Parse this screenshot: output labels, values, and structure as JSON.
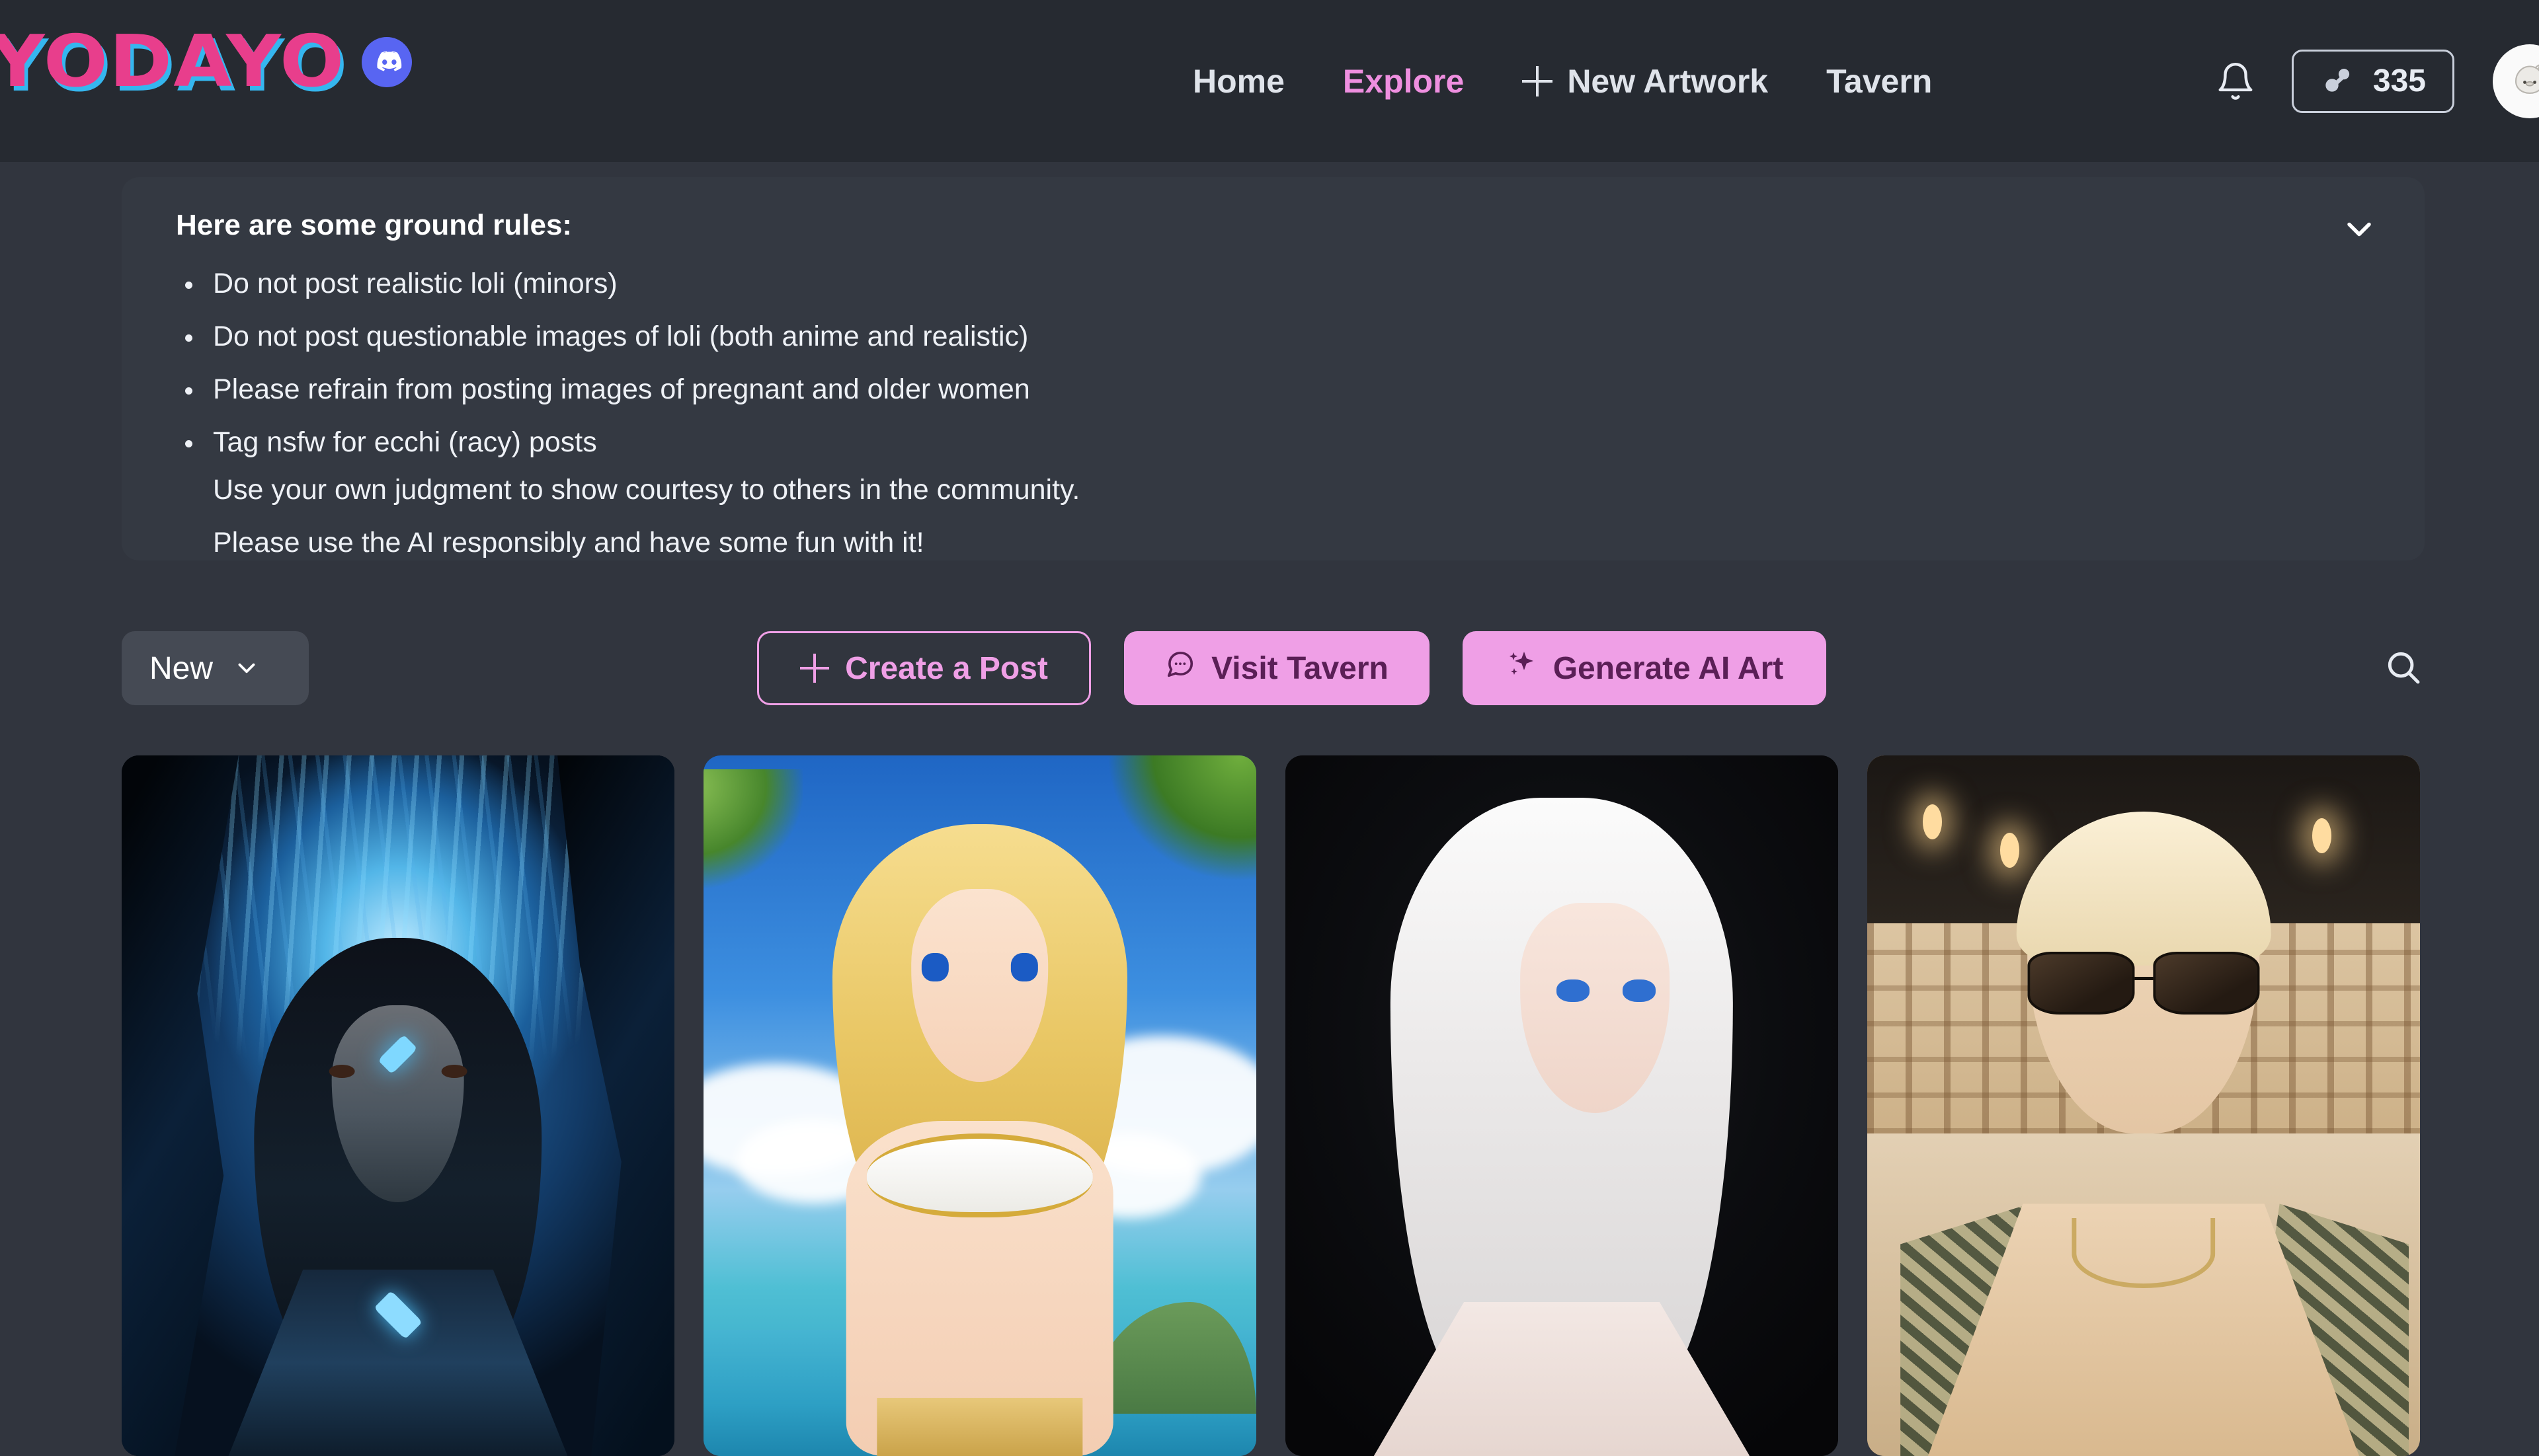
{
  "header": {
    "logo_text": "YODAYO",
    "discord_icon": "discord-icon",
    "nav": [
      {
        "label": "Home",
        "active": false,
        "icon": null
      },
      {
        "label": "Explore",
        "active": true,
        "icon": null
      },
      {
        "label": "New Artwork",
        "active": false,
        "icon": "plus-icon"
      },
      {
        "label": "Tavern",
        "active": false,
        "icon": null
      }
    ],
    "notifications_icon": "bell-icon",
    "coin": {
      "icon": "coin-icon",
      "amount": "335"
    },
    "avatar": "user-avatar"
  },
  "rules_panel": {
    "title": "Here are some ground rules:",
    "items": [
      "Do not post realistic loli (minors)",
      "Do not post questionable images of loli (both anime and realistic)",
      "Please refrain from posting images of pregnant and older women",
      "Tag nsfw for ecchi (racy) posts"
    ],
    "footer_lines": [
      "Use your own judgment to show courtesy to others in the community.",
      "Please use the AI responsibly and have some fun with it!"
    ],
    "collapse_icon": "chevron-down-icon"
  },
  "toolbar": {
    "sort": {
      "value": "New",
      "icon": "chevron-down-icon"
    },
    "create_post_label": "Create a Post",
    "visit_tavern_label": "Visit Tavern",
    "generate_ai_art_label": "Generate AI Art",
    "search_icon": "search-icon"
  },
  "gallery": {
    "cards": [
      {
        "alt": "Dark-haired woman in glowing blue crystal cave"
      },
      {
        "alt": "Blonde anime girl in white and gold bikini at tropical beach"
      },
      {
        "alt": "White-haired anime woman with blue eyes in lace dress on dark background"
      },
      {
        "alt": "Blond man with sunglasses and open patterned shirt in a gallery"
      }
    ]
  },
  "colors": {
    "page_bg": "#31353e",
    "header_bg": "#262a31",
    "panel_bg": "#343942",
    "accent_pink": "#ef9fe6",
    "logo_pink": "#e83e8c",
    "logo_cyan": "#35b6ef",
    "discord_blurple": "#5865f2",
    "chip_bg": "#454a54"
  }
}
